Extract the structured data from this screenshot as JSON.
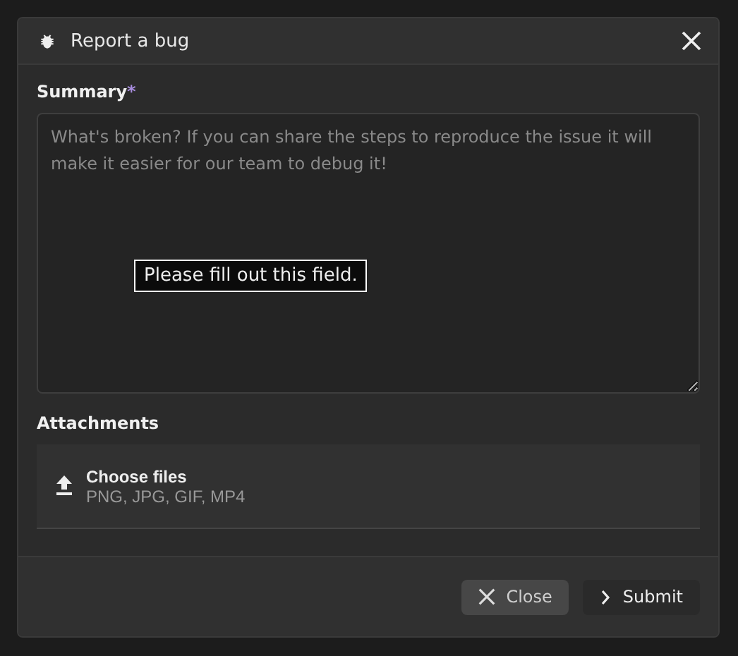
{
  "dialog": {
    "title": "Report a bug"
  },
  "summary": {
    "label": "Summary",
    "required_mark": "*",
    "placeholder": "What's broken? If you can share the steps to reproduce the issue it will make it easier for our team to debug it!",
    "tooltip": "Please fill out this field."
  },
  "attachments": {
    "label": "Attachments",
    "button": "Choose files",
    "hint": "PNG, JPG, GIF, MP4"
  },
  "buttons": [
    {
      "kind": "close",
      "label": "Close"
    },
    {
      "kind": "submit",
      "label": "Submit"
    }
  ]
}
